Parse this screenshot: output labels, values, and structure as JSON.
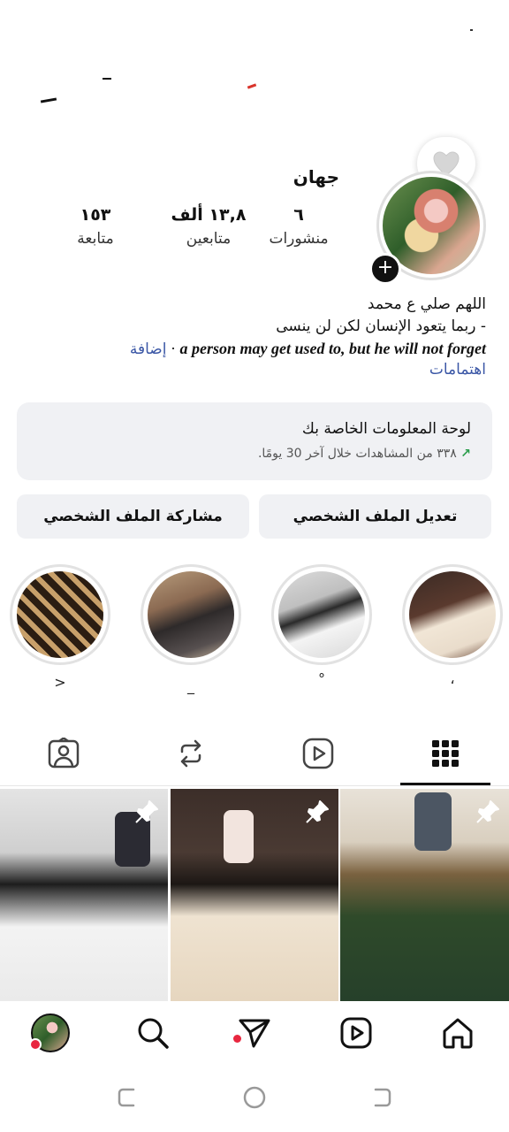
{
  "profile": {
    "username": "جهان",
    "stats": [
      {
        "value": "٦",
        "label": "منشورات"
      },
      {
        "value": "١٣,٨ ألف",
        "label": "متابعين"
      },
      {
        "value": "١٥٣",
        "label": "متابعة"
      }
    ],
    "bio_line1": "اللهم صلي ع محمد",
    "bio_line2": "- ربما يتعود الإنسان لكن لن ينسى",
    "bio_english": "a person may get used to, but he will not forget",
    "bio_separator": "·",
    "add_link": "إضافة",
    "interests_link": "اهتمامات"
  },
  "dashboard": {
    "title": "لوحة المعلومات الخاصة بك",
    "subtitle": "٣٣٨ من المشاهدات خلال آخر 30 يومًا.",
    "trend_color": "#2a9d4b"
  },
  "buttons": {
    "edit_profile": "تعديل الملف الشخصي",
    "share_profile": "مشاركة الملف الشخصي"
  },
  "highlights": [
    {
      "label": "،"
    },
    {
      "label": "°"
    },
    {
      "label": "_"
    },
    {
      "label": ">"
    }
  ],
  "tabs": [
    "grid-icon",
    "reels-icon",
    "reposts-icon",
    "tagged-icon"
  ],
  "nav": [
    "home-icon",
    "reels-icon",
    "direct-icon",
    "search-icon",
    "profile-avatar"
  ],
  "colors": {
    "accent_link": "#3b57a6",
    "notification_dot": "#e8263f"
  }
}
